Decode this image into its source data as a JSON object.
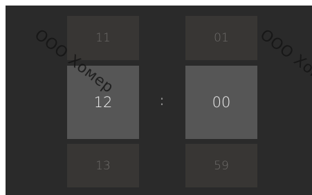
{
  "hours": {
    "previous": "11",
    "selected": "12",
    "next": "13"
  },
  "separator": ":",
  "minutes": {
    "previous": "01",
    "selected": "00",
    "next": "59"
  },
  "watermarks": [
    "ООО Хомер",
    "ООО Хомер"
  ],
  "colors": {
    "background": "#2a2a2a",
    "cell_dim": "#383634",
    "cell_selected": "#565656",
    "text_dim": "#6e6c6a",
    "text_selected": "#f0f0f0"
  }
}
